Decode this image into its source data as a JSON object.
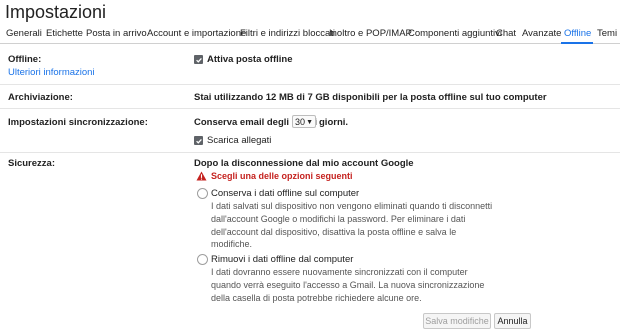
{
  "header": {
    "title": "Impostazioni"
  },
  "tabs": [
    {
      "label": "Generali"
    },
    {
      "label": "Etichette"
    },
    {
      "label": "Posta in arrivo"
    },
    {
      "label": "Account e importazione"
    },
    {
      "label": "Filtri e indirizzi bloccati"
    },
    {
      "label": "Inoltro e POP/IMAP"
    },
    {
      "label": "Componenti aggiuntivi"
    },
    {
      "label": "Chat"
    },
    {
      "label": "Avanzate"
    },
    {
      "label": "Offline"
    },
    {
      "label": "Temi"
    }
  ],
  "active_tab": "Offline",
  "offline": {
    "label": "Offline:",
    "link": "Ulteriori informazioni",
    "checkbox_label": "Attiva posta offline",
    "checked": true
  },
  "storage": {
    "label": "Archiviazione:",
    "text": "Stai utilizzando 12 MB di 7 GB disponibili per la posta offline sul tuo computer"
  },
  "sync": {
    "label": "Impostazioni sincronizzazione:",
    "prefix": "Conserva email degli ultimi",
    "days_value": "30",
    "suffix": "giorni.",
    "attachments_label": "Scarica allegati",
    "attachments_checked": true
  },
  "security": {
    "label": "Sicurezza:",
    "heading": "Dopo la disconnessione dal mio account Google",
    "warning": "Scegli una delle opzioni seguenti",
    "option1_title": "Conserva i dati offline sul computer",
    "option1_line1": "I dati salvati sul dispositivo non vengono eliminati quando ti disconnetti",
    "option1_line2": "dall'account Google o modifichi la password. Per eliminare i dati",
    "option1_line3": "dell'account dal dispositivo, disattiva la posta offline e salva le",
    "option1_line4": "modifiche.",
    "option2_title": "Rimuovi i dati offline dal computer",
    "option2_line1": "I dati dovranno essere nuovamente sincronizzati con il computer",
    "option2_line2": "quando verrà eseguito l'accesso a Gmail. La nuova sincronizzazione",
    "option2_line3": "della casella di posta potrebbe richiedere alcune ore."
  },
  "footer": {
    "save_label": "Salva modifiche",
    "cancel_label": "Annulla"
  },
  "colors": {
    "accent": "#1a73e8",
    "warning": "#c5221f"
  }
}
